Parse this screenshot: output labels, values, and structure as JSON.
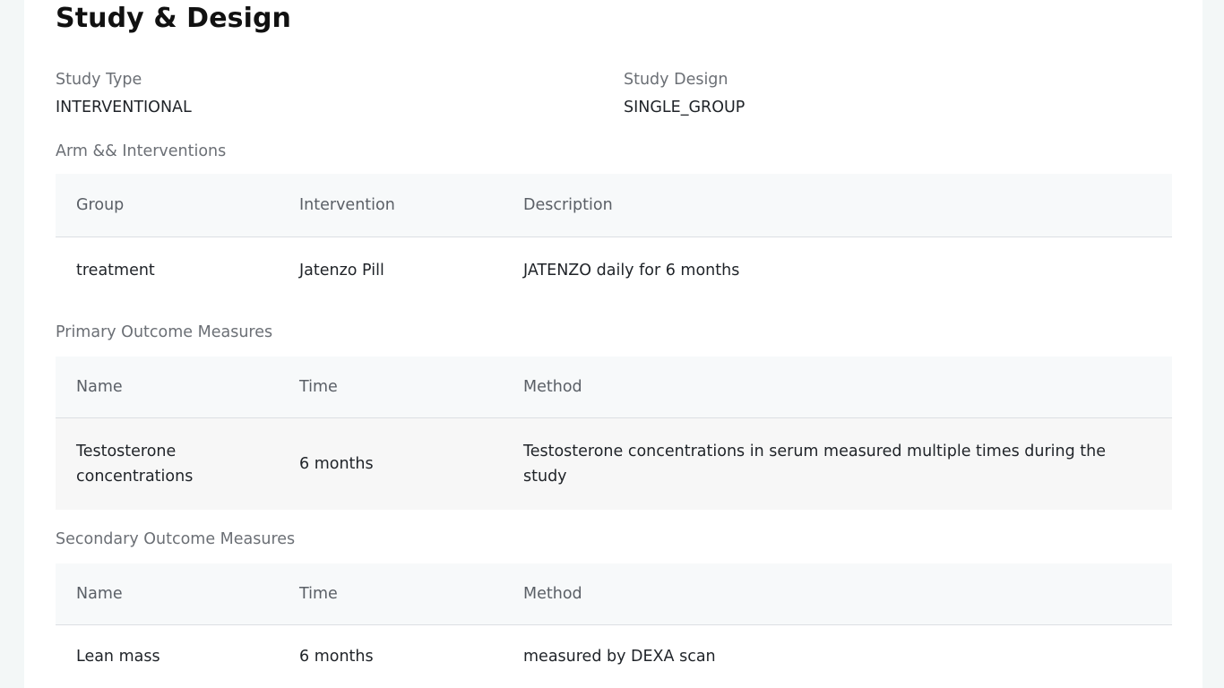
{
  "page": {
    "title": "Study & Design"
  },
  "study_type": {
    "label": "Study Type",
    "value": "INTERVENTIONAL"
  },
  "study_design": {
    "label": "Study Design",
    "value": "SINGLE_GROUP"
  },
  "arms": {
    "label": "Arm && Interventions",
    "headers": [
      "Group",
      "Intervention",
      "Description"
    ],
    "rows": [
      [
        "treatment",
        "Jatenzo Pill",
        "JATENZO daily for 6 months"
      ]
    ]
  },
  "primary": {
    "label": "Primary Outcome Measures",
    "headers": [
      "Name",
      "Time",
      "Method"
    ],
    "rows": [
      [
        "Testosterone concentrations",
        "6 months",
        "Testosterone concentrations in serum measured multiple times during the study"
      ]
    ]
  },
  "secondary": {
    "label": "Secondary Outcome Measures",
    "headers": [
      "Name",
      "Time",
      "Method"
    ],
    "rows": [
      [
        "Lean mass",
        "6 months",
        "measured by DEXA scan"
      ]
    ]
  }
}
